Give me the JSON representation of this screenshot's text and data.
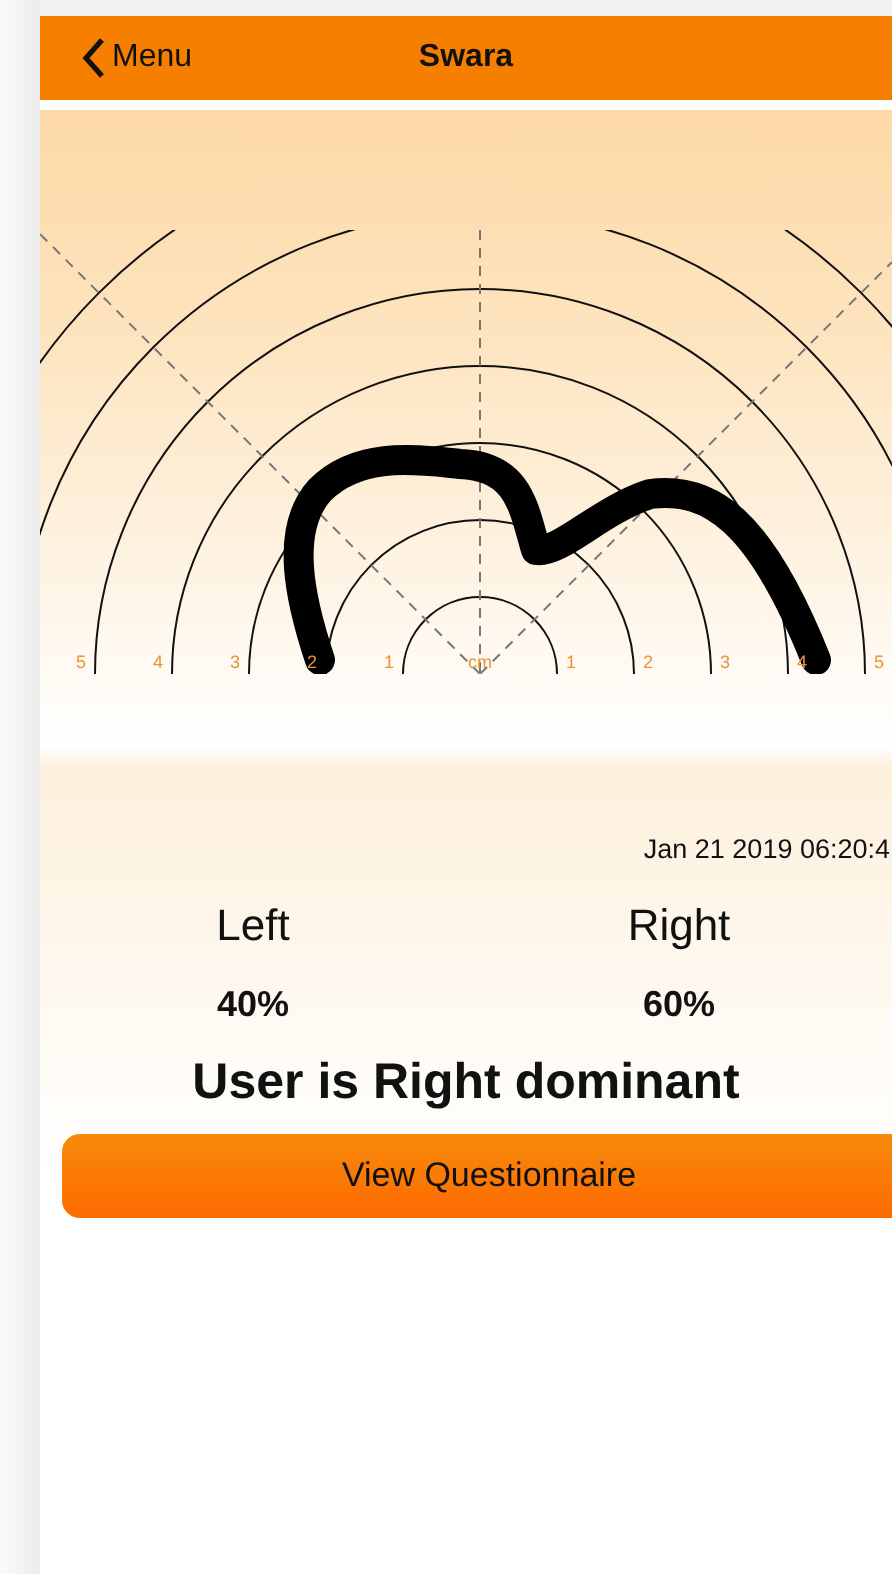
{
  "nav": {
    "back": "Menu",
    "title": "Swara"
  },
  "target": {
    "left_ticks": [
      "5",
      "4",
      "3",
      "2",
      "1"
    ],
    "center": "cm",
    "right_ticks": [
      "1",
      "2",
      "3",
      "4",
      "5"
    ]
  },
  "timestamp": "Jan 21 2019 06:20:4",
  "sides": [
    {
      "label": "Left",
      "percent": "40%"
    },
    {
      "label": "Right",
      "percent": "60%"
    }
  ],
  "result": "User is Right dominant",
  "button": "View Questionnaire"
}
